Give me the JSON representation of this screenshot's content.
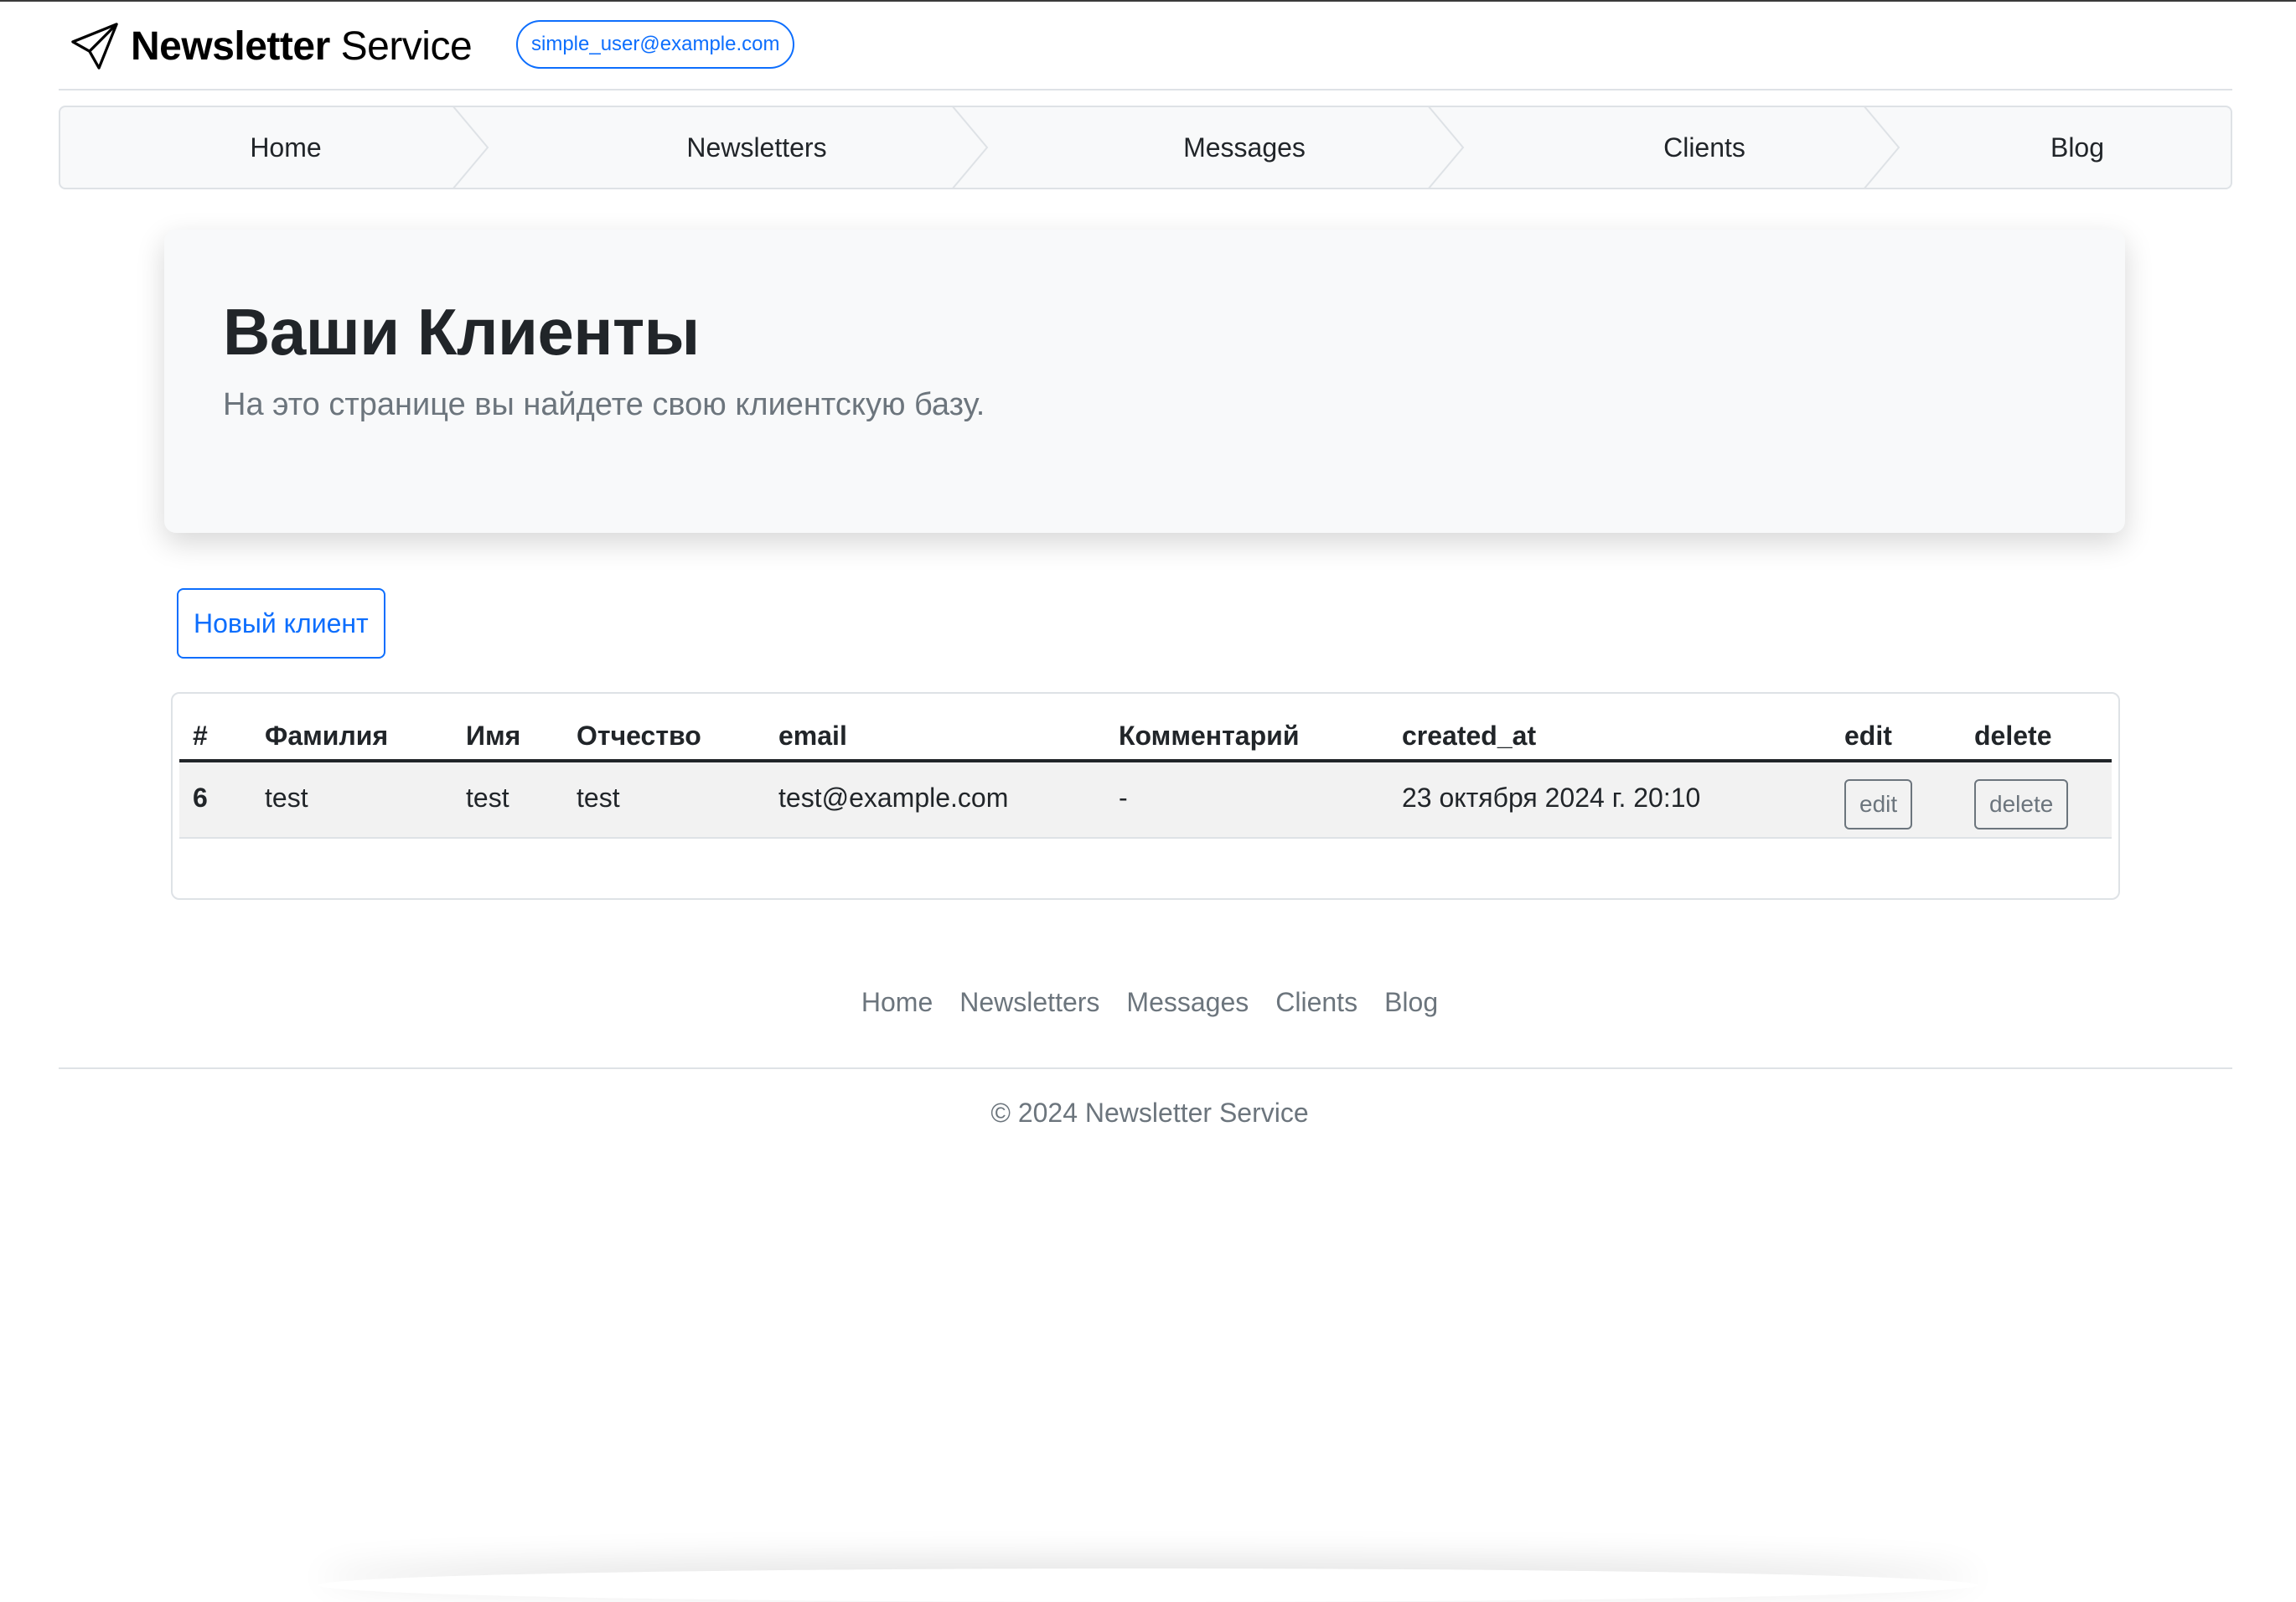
{
  "brand": {
    "name_bold": "Newsletter",
    "name_light": "Service",
    "icon": "paper-plane-icon"
  },
  "user": {
    "email": "simple_user@example.com"
  },
  "nav": {
    "items": [
      {
        "label": "Home"
      },
      {
        "label": "Newsletters"
      },
      {
        "label": "Messages"
      },
      {
        "label": "Clients"
      },
      {
        "label": "Blog"
      }
    ]
  },
  "hero": {
    "title": "Ваши Клиенты",
    "subtitle": "На это странице вы найдете свою клиентскую базу."
  },
  "actions": {
    "new_client_label": "Новый клиент"
  },
  "table": {
    "columns": [
      "#",
      "Фамилия",
      "Имя",
      "Отчество",
      "email",
      "Комментарий",
      "created_at",
      "edit",
      "delete"
    ],
    "rows": [
      {
        "id": "6",
        "last_name": "test",
        "first_name": "test",
        "patronymic": "test",
        "email": "test@example.com",
        "comment": "-",
        "created_at": "23 октября 2024 г. 20:10",
        "edit_label": "edit",
        "delete_label": "delete"
      }
    ]
  },
  "footer": {
    "links": [
      {
        "label": "Home"
      },
      {
        "label": "Newsletters"
      },
      {
        "label": "Messages"
      },
      {
        "label": "Clients"
      },
      {
        "label": "Blog"
      }
    ],
    "copyright": "© 2024 Newsletter Service"
  },
  "colors": {
    "accent": "#0d6efd",
    "muted": "#6c757d",
    "panel": "#f8f9fa",
    "text": "#212529"
  }
}
